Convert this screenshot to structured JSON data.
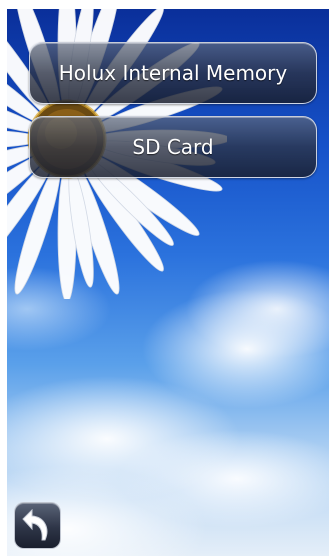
{
  "menu": {
    "internal_memory_label": "Holux Internal Memory",
    "sd_card_label": "SD Card"
  },
  "icons": {
    "back": "back-arrow-icon",
    "wallpaper": "daisy-sky-wallpaper"
  },
  "colors": {
    "button_bg": "#2e3547",
    "button_text": "#ffffff",
    "sky": "#1652c9"
  }
}
